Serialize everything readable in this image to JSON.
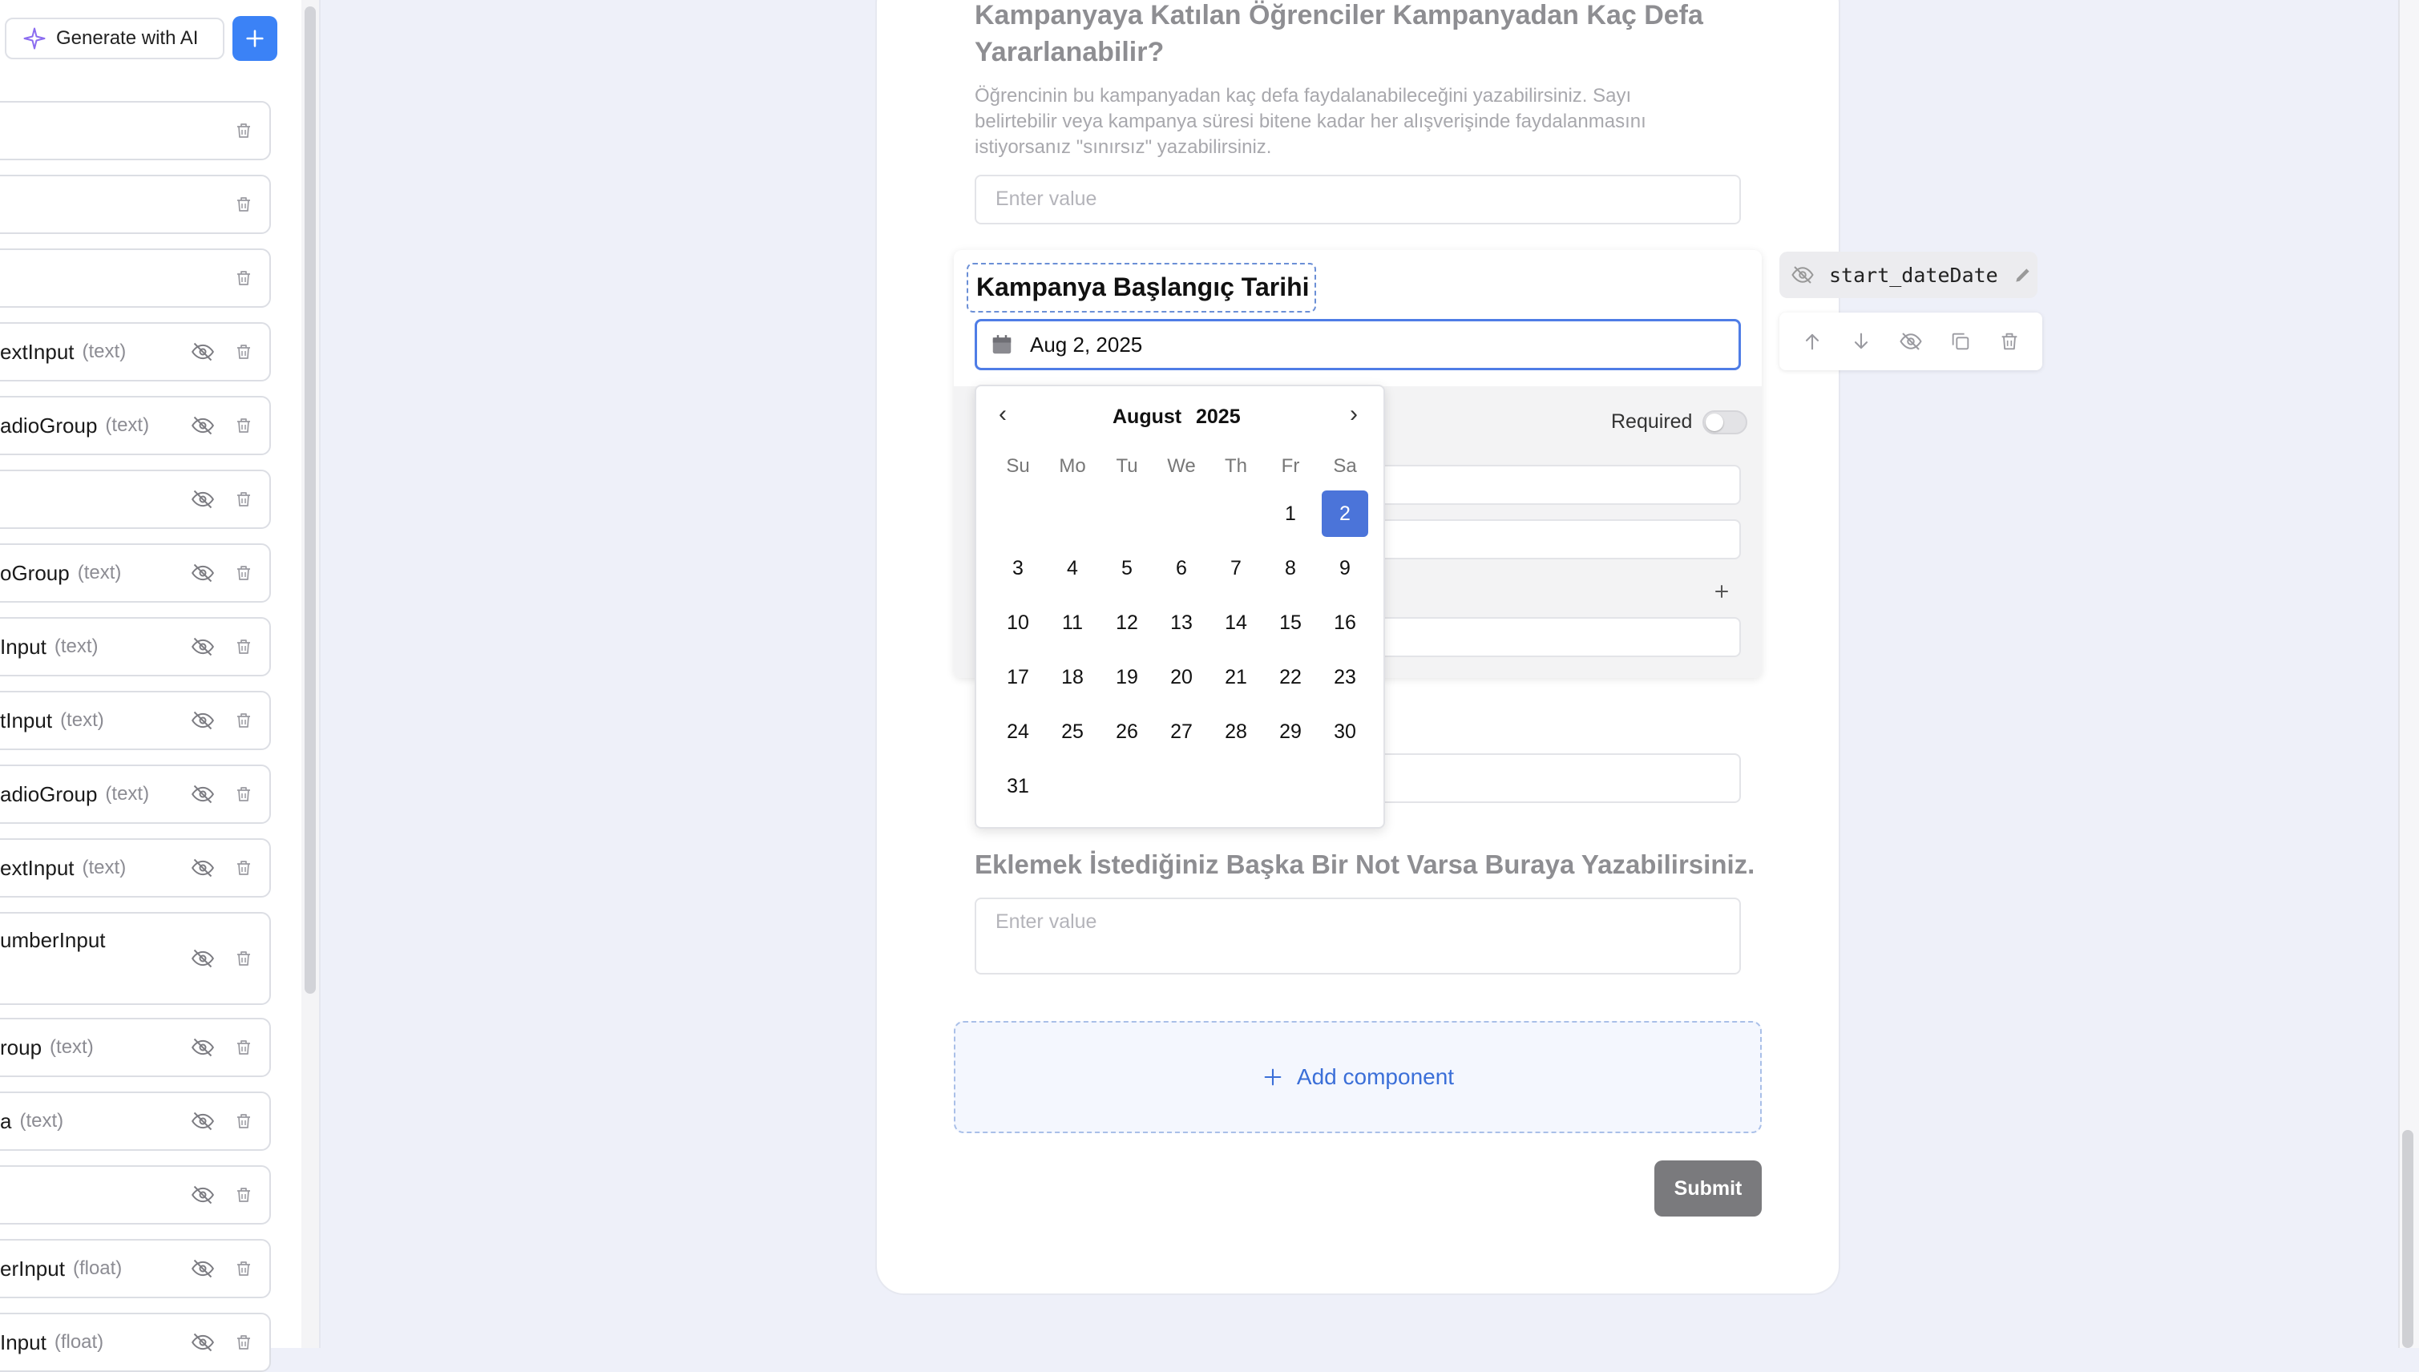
{
  "sidebar": {
    "generate_label": "Generate with AI",
    "items": [
      {
        "label": "",
        "type": "",
        "hidden": false
      },
      {
        "label": "",
        "type": "",
        "hidden": false
      },
      {
        "label": "",
        "type": "",
        "hidden": false
      },
      {
        "label": "extInput",
        "type": "(text)",
        "hidden": true
      },
      {
        "label": "adioGroup",
        "type": "(text)",
        "hidden": true
      },
      {
        "label": "",
        "type": "",
        "hidden": true
      },
      {
        "label": "oGroup",
        "type": "(text)",
        "hidden": true
      },
      {
        "label": "Input",
        "type": "(text)",
        "hidden": true
      },
      {
        "label": "tInput",
        "type": "(text)",
        "hidden": true
      },
      {
        "label": "adioGroup",
        "type": "(text)",
        "hidden": true
      },
      {
        "label": "extInput",
        "type": "(text)",
        "hidden": true
      },
      {
        "label": "umberInput",
        "type": "",
        "hidden": true
      },
      {
        "label": "roup",
        "type": "(text)",
        "hidden": true
      },
      {
        "label": "a",
        "type": "(text)",
        "hidden": true
      },
      {
        "label": "",
        "type": "",
        "hidden": true
      },
      {
        "label": "erInput",
        "type": "(float)",
        "hidden": true
      },
      {
        "label": "Input",
        "type": "(float)",
        "hidden": true
      }
    ]
  },
  "form": {
    "q1_title_line1": "Kampanyaya Katılan Öğrenciler Kampanyadan Kaç Defa",
    "q1_title_line2": "Yararlanabilir?",
    "q1_desc_line1": "Öğrencinin bu kampanyadan kaç defa faydalanabileceğini yazabilirsiniz. Sayı",
    "q1_desc_line2": "belirtebilir veya kampanya süresi bitene kadar her alışverişinde faydalanmasını",
    "q1_desc_line3": "istiyorsanız \"sınırsız\" yazabilirsiniz.",
    "q1_placeholder": "Enter value",
    "selected_title": "Kampanya Başlangıç Tarihi",
    "selected_value": "Aug 2, 2025",
    "required_label": "Required",
    "q_note_title": "Eklemek İstediğiniz Başka Bir Not Varsa Buraya Yazabilirsiniz.",
    "q_note_placeholder": "Enter value",
    "add_component_label": "Add component",
    "submit_label": "Submit"
  },
  "calendar": {
    "month": "August",
    "year": "2025",
    "prev": "‹",
    "next": "›",
    "weekdays": [
      "Su",
      "Mo",
      "Tu",
      "We",
      "Th",
      "Fr",
      "Sa"
    ],
    "first_weekday_index": 5,
    "days_in_month": 31,
    "selected_day": 2,
    "selected_color": "#4b74d9"
  },
  "field_panel": {
    "field_name": "start_dateDate",
    "tools": [
      "arrow-up-icon",
      "arrow-down-icon",
      "eye-off-icon",
      "duplicate-icon",
      "trash-icon"
    ]
  },
  "colors": {
    "accent": "#3b82f6",
    "focus": "#4f7de6",
    "background": "#eef0f9"
  }
}
